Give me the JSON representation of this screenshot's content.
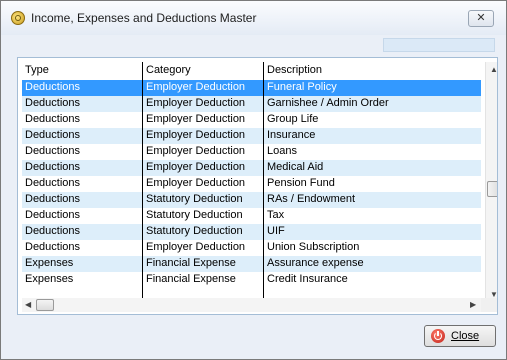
{
  "window": {
    "title": "Income, Expenses and Deductions Master",
    "close_glyph": "✕"
  },
  "search": {
    "value": ""
  },
  "table": {
    "columns": [
      "Type",
      "Category",
      "Description"
    ],
    "rows": [
      [
        "Deductions",
        "Employer Deduction",
        "Funeral Policy"
      ],
      [
        "Deductions",
        "Employer Deduction",
        "Garnishee / Admin Order"
      ],
      [
        "Deductions",
        "Employer Deduction",
        "Group Life"
      ],
      [
        "Deductions",
        "Employer Deduction",
        "Insurance"
      ],
      [
        "Deductions",
        "Employer Deduction",
        "Loans"
      ],
      [
        "Deductions",
        "Employer Deduction",
        "Medical Aid"
      ],
      [
        "Deductions",
        "Employer Deduction",
        "Pension Fund"
      ],
      [
        "Deductions",
        "Statutory Deduction",
        "RAs / Endowment"
      ],
      [
        "Deductions",
        "Statutory Deduction",
        "Tax"
      ],
      [
        "Deductions",
        "Statutory Deduction",
        "UIF"
      ],
      [
        "Deductions",
        "Employer Deduction",
        "Union Subscription"
      ],
      [
        "Expenses",
        "Financial Expense",
        "Assurance expense"
      ],
      [
        "Expenses",
        "Financial Expense",
        "Credit Insurance"
      ]
    ],
    "selected_row": 0
  },
  "scroll": {
    "up": "▲",
    "down": "▼",
    "left": "◀",
    "right": "▶"
  },
  "footer": {
    "close_label": "Close"
  },
  "colors": {
    "selection": "#3399ff",
    "alt_row": "#ddeefa"
  }
}
